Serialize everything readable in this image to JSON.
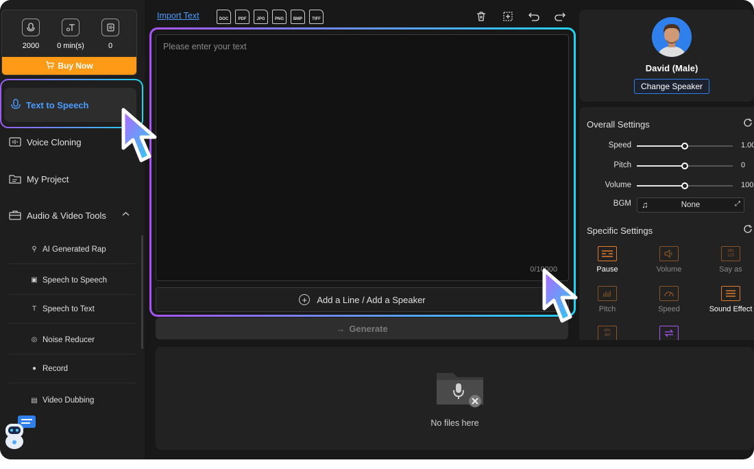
{
  "stats": {
    "chars_value": "2000",
    "minutes_value": "0 min(s)",
    "count_value": "0",
    "buy_label": "Buy Now"
  },
  "nav": {
    "text_to_speech": "Text to Speech",
    "voice_cloning": "Voice Cloning",
    "my_project": "My Project",
    "audio_video_tools": "Audio & Video Tools",
    "sub_items": [
      "AI Generated Rap",
      "Speech to Speech",
      "Speech to Text",
      "Noise Reducer",
      "Record",
      "Video Dubbing"
    ]
  },
  "toolbar": {
    "import_text": "Import Text",
    "file_types": [
      "DOC",
      "PDF",
      "JPG",
      "PNG",
      "BMP",
      "TIFF"
    ]
  },
  "editor": {
    "placeholder": "Please enter your text",
    "counter": "0/10000",
    "add_line_label": "Add a Line / Add a Speaker",
    "generate_label": "Generate"
  },
  "files": {
    "empty_label": "No files here"
  },
  "speaker": {
    "name": "David (Male)",
    "change_label": "Change Speaker"
  },
  "overall": {
    "title": "Overall Settings",
    "speed_label": "Speed",
    "speed_value": "1.00",
    "pitch_label": "Pitch",
    "pitch_value": "0",
    "volume_label": "Volume",
    "volume_value": "100",
    "slider_fraction": 0.5,
    "bgm_label": "BGM",
    "bgm_value": "None"
  },
  "specific": {
    "title": "Specific Settings",
    "items": [
      "Pause",
      "Volume",
      "Say as",
      "Pitch",
      "Speed",
      "Sound Effect"
    ],
    "icon_text_sayas": "abc\n123",
    "icon_text_abcdef": "abc\ndef"
  },
  "colors": {
    "accent_blue": "#4a9cff",
    "buy_orange": "#ff9a16",
    "spec_orange": "#e07b2a"
  }
}
